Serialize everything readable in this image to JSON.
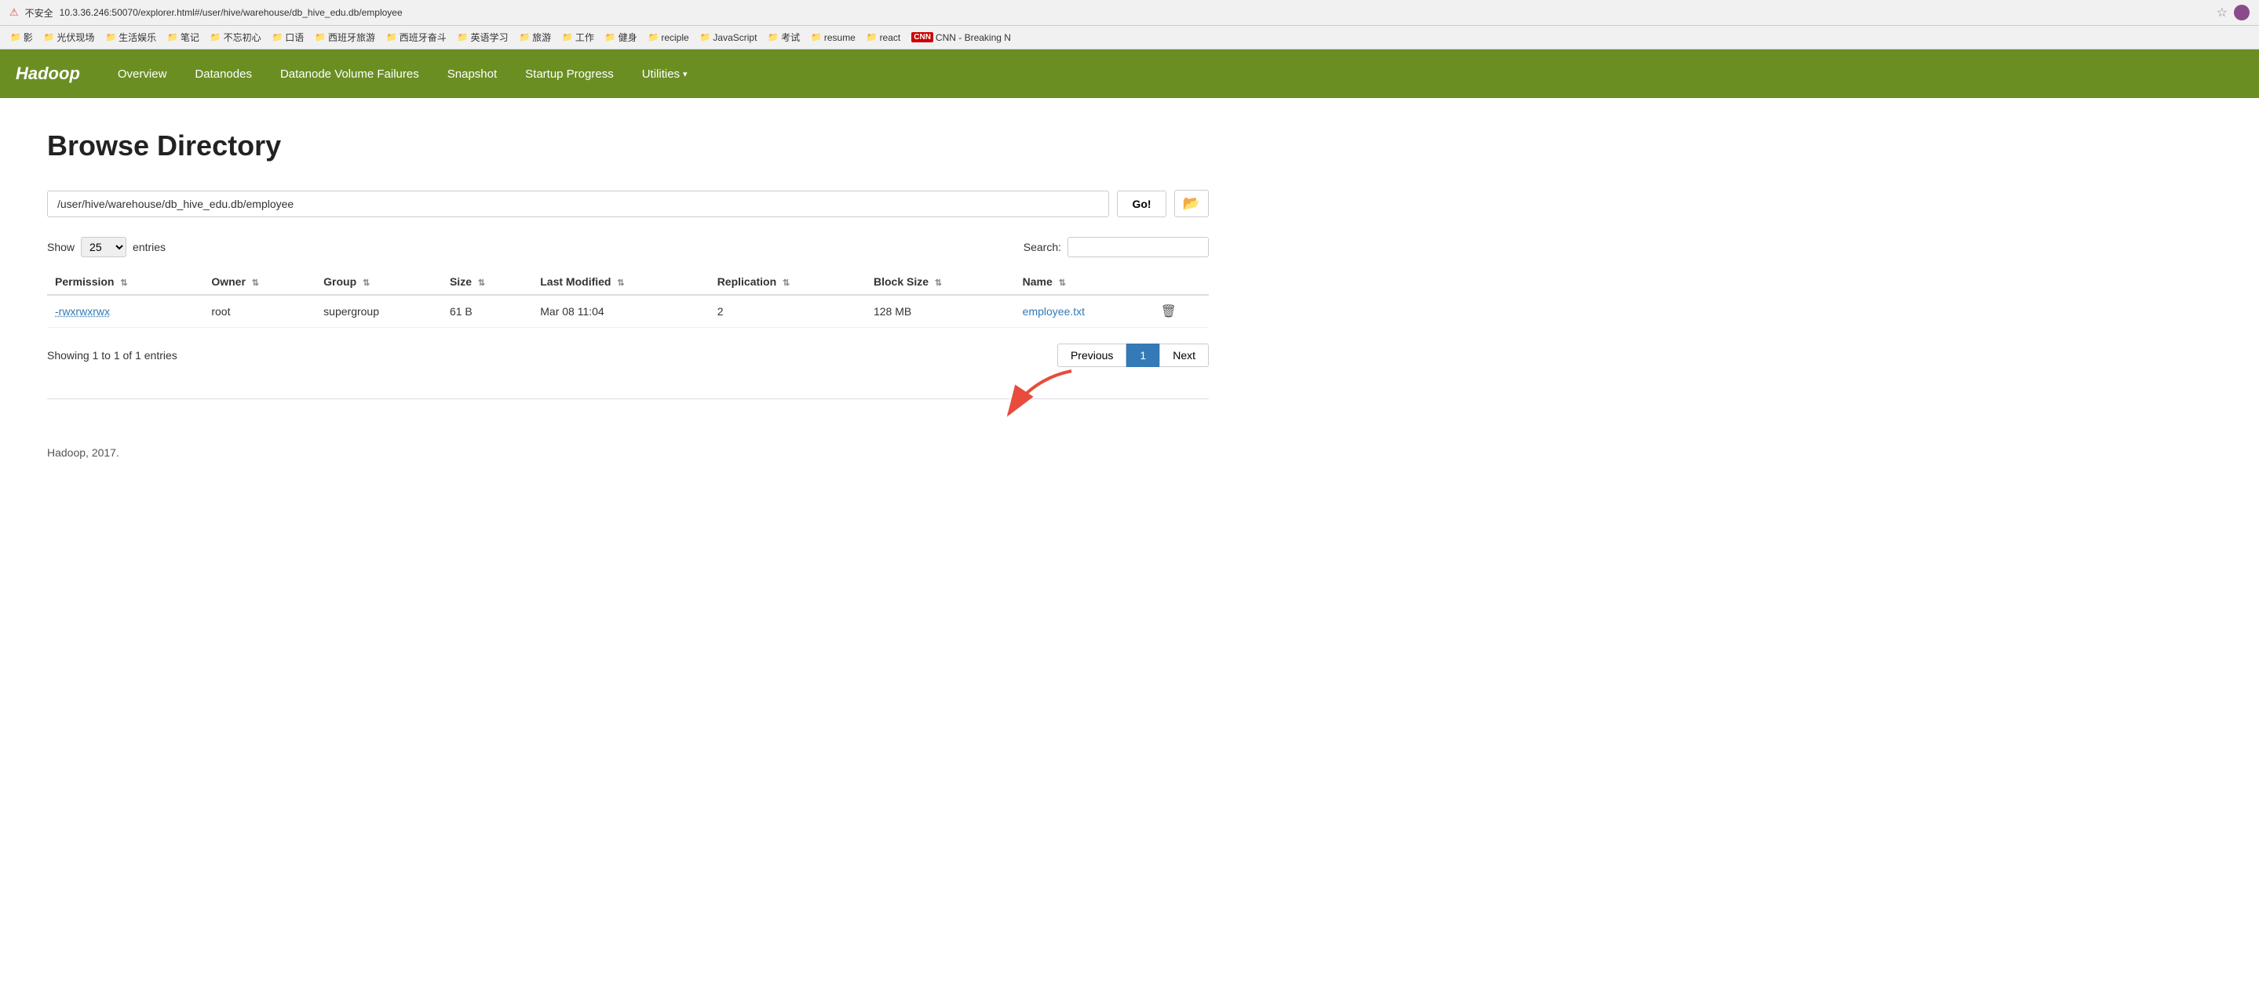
{
  "browser": {
    "url": "10.3.36.246:50070/explorer.html#/user/hive/warehouse/db_hive_edu.db/employee",
    "security_label": "不安全",
    "bookmarks": [
      {
        "label": "影"
      },
      {
        "label": "光伏现场"
      },
      {
        "label": "生活娱乐"
      },
      {
        "label": "笔记"
      },
      {
        "label": "不忘初心"
      },
      {
        "label": "口语"
      },
      {
        "label": "西班牙旅游"
      },
      {
        "label": "西班牙奋斗"
      },
      {
        "label": "英语学习"
      },
      {
        "label": "旅游"
      },
      {
        "label": "工作"
      },
      {
        "label": "健身"
      },
      {
        "label": "reciple"
      },
      {
        "label": "JavaScript"
      },
      {
        "label": "考试"
      },
      {
        "label": "resume"
      },
      {
        "label": "react"
      },
      {
        "label": "CNN - Breaking N"
      }
    ]
  },
  "nav": {
    "brand": "Hadoop",
    "items": [
      {
        "label": "Overview"
      },
      {
        "label": "Datanodes"
      },
      {
        "label": "Datanode Volume Failures"
      },
      {
        "label": "Snapshot"
      },
      {
        "label": "Startup Progress"
      },
      {
        "label": "Utilities",
        "dropdown": true
      }
    ]
  },
  "page": {
    "title": "Browse Directory"
  },
  "path_bar": {
    "path_value": "/user/hive/warehouse/db_hive_edu.db/employee",
    "go_label": "Go!",
    "folder_icon": "📁"
  },
  "table": {
    "show_label": "Show",
    "show_value": "25",
    "entries_label": "entries",
    "search_label": "Search:",
    "columns": [
      {
        "label": "Permission"
      },
      {
        "label": "Owner"
      },
      {
        "label": "Group"
      },
      {
        "label": "Size"
      },
      {
        "label": "Last Modified"
      },
      {
        "label": "Replication"
      },
      {
        "label": "Block Size"
      },
      {
        "label": "Name"
      }
    ],
    "rows": [
      {
        "permission": "-rwxrwxrwx",
        "owner": "root",
        "group": "supergroup",
        "size": "61 B",
        "last_modified": "Mar 08 11:04",
        "replication": "2",
        "block_size": "128 MB",
        "name": "employee.txt"
      }
    ],
    "showing_text": "Showing 1 to 1 of 1 entries",
    "pagination": {
      "previous_label": "Previous",
      "current_page": "1",
      "next_label": "Next"
    }
  },
  "footer": {
    "text": "Hadoop, 2017."
  }
}
